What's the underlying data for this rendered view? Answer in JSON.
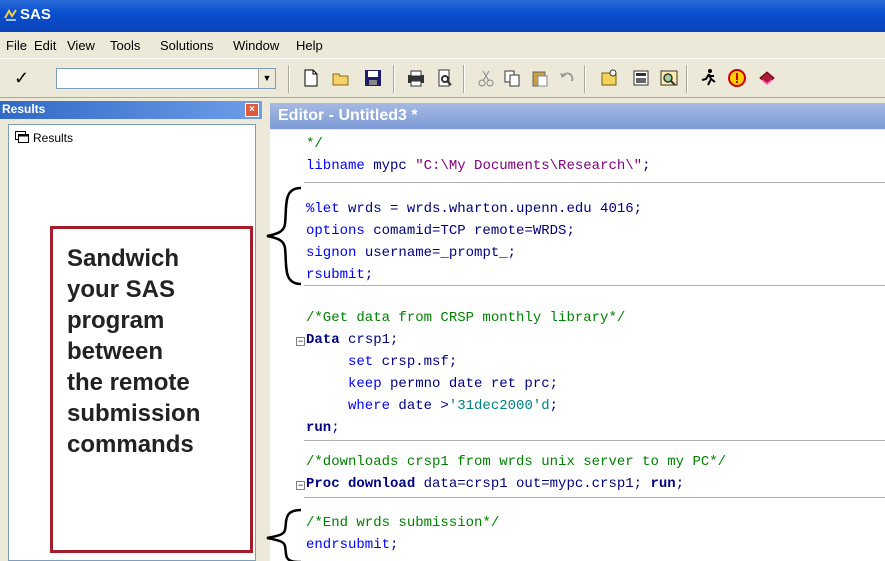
{
  "app": {
    "title": "SAS"
  },
  "menu": {
    "items": [
      "File",
      "Edit",
      "View",
      "Tools",
      "Solutions",
      "Window",
      "Help"
    ]
  },
  "toolbar": {
    "check_label": "✓",
    "command_value": "",
    "icons": [
      "new-icon",
      "open-icon",
      "save-icon",
      "print-icon",
      "print-preview-icon",
      "cut-icon",
      "copy-icon",
      "paste-icon",
      "undo-icon",
      "new-library-icon",
      "sas-explorer-icon",
      "find-icon",
      "run-icon",
      "break-icon",
      "help-icon"
    ]
  },
  "results": {
    "header": "Results",
    "close_label": "×",
    "tree_items": [
      "Results"
    ]
  },
  "editor": {
    "header": "Editor - Untitled3 *"
  },
  "callout": {
    "lines": [
      "Sandwich",
      "your SAS",
      "program",
      "between",
      "the remote",
      "submission",
      "commands"
    ]
  },
  "code": {
    "lines": [
      "*/",
      "libname mypc \"C:\\My Documents\\Research\\\";",
      "%let wrds = wrds.wharton.upenn.edu 4016;",
      "options comamid=TCP remote=WRDS;",
      "signon username=_prompt_;",
      "rsubmit;",
      "/*Get data from CRSP monthly library*/",
      "Data crsp1;",
      "set crsp.msf;",
      "keep permno date ret prc;",
      "where date >'31dec2000'd;",
      "run;",
      "/*downloads crsp1 from wrds unix server to my PC*/",
      "Proc download data=crsp1 out=mypc.crsp1; run;",
      "/*End wrds submission*/",
      "endrsubmit;"
    ]
  },
  "colors": {
    "titlebar": "#0a4fd0",
    "callout_border": "#a51d2d",
    "comment": "#008000",
    "keyword": "#0000ff"
  }
}
